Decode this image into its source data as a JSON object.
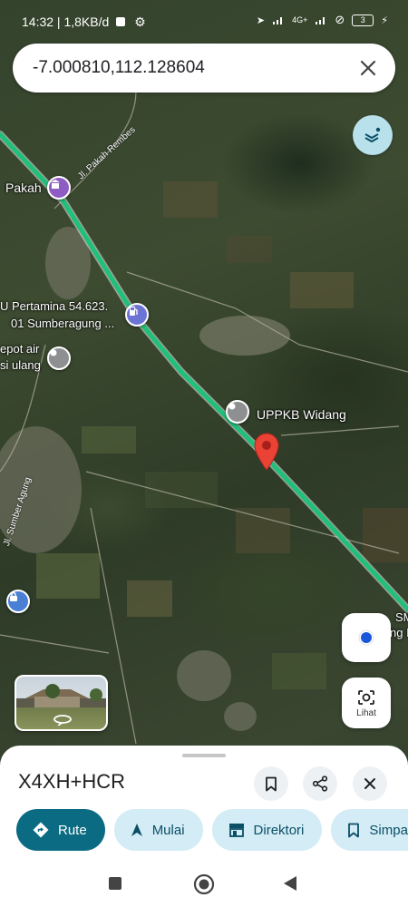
{
  "status_bar": {
    "time": "14:32",
    "network_speed": "1,8KB/d",
    "signal_label": "4G+",
    "battery": "3"
  },
  "search": {
    "query": "-7.000810,112.128604"
  },
  "map": {
    "places": [
      {
        "label": "Pakah"
      },
      {
        "label": "U Pertamina 54.623."
      },
      {
        "label": "01 Sumberagung ..."
      },
      {
        "label": "epot air"
      },
      {
        "label": "si ulang"
      },
      {
        "label": "UPPKB Widang"
      },
      {
        "label": "SM"
      },
      {
        "label": "ng I"
      }
    ],
    "roads": [
      {
        "label": "Jl. Pakah Rembes"
      },
      {
        "label": "Jl. Sumber Agung"
      }
    ]
  },
  "buttons": {
    "lihat_label": "Lihat"
  },
  "sheet": {
    "title": "X4XH+HCR",
    "chips": [
      {
        "label": "Rute",
        "icon": "directions-icon"
      },
      {
        "label": "Mulai",
        "icon": "navigation-icon"
      },
      {
        "label": "Direktori",
        "icon": "storefront-icon"
      },
      {
        "label": "Simpa",
        "icon": "bookmark-icon"
      }
    ]
  },
  "colors": {
    "route": "#20c07a",
    "pin": "#ea4335",
    "primary_chip": "#0b6b82",
    "chip": "#d3ecf5",
    "location_dot": "#1a56db"
  }
}
